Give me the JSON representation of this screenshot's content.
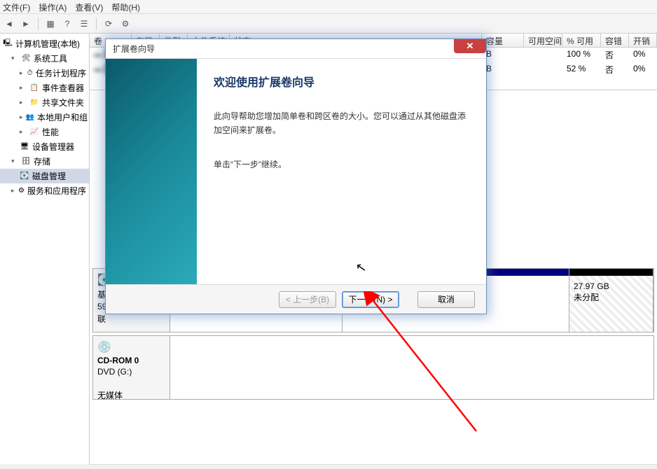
{
  "menu": {
    "file": "文件(F)",
    "action": "操作(A)",
    "view": "查看(V)",
    "help": "帮助(H)"
  },
  "tree": {
    "root": "计算机管理(本地)",
    "systools": "系统工具",
    "scheduler": "任务计划程序",
    "eventviewer": "事件查看器",
    "shared": "共享文件夹",
    "localusers": "本地用户和组",
    "perf": "性能",
    "devmgr": "设备管理器",
    "storage": "存储",
    "diskmgmt": "磁盘管理",
    "services": "服务和应用程序"
  },
  "listHeader": {
    "vol": "卷",
    "layout": "布局",
    "type": "类型",
    "fs": "文件系统",
    "status": "状态",
    "cap": "容量",
    "free": "可用空间",
    "pct": "% 可用",
    "fault": "容错",
    "over": "开销"
  },
  "rows": [
    {
      "cap": "B",
      "free": "",
      "pct": "100 %",
      "fault": "否",
      "over": "0%"
    },
    {
      "cap": "B",
      "free": "",
      "pct": "52 %",
      "fault": "否",
      "over": "0%"
    }
  ],
  "disk0": {
    "label": "基",
    "line2": "59",
    "line3": "联"
  },
  "unalloc": {
    "size": "27.97 GB",
    "status": "未分配"
  },
  "cdrom": {
    "title": "CD-ROM 0",
    "drive": "DVD (G:)",
    "status": "无媒体"
  },
  "wizard": {
    "title": "扩展卷向导",
    "heading": "欢迎使用扩展卷向导",
    "p1": "此向导帮助您增加简单卷和跨区卷的大小。您可以通过从其他磁盘添加空间来扩展卷。",
    "p2": "单击“下一步”继续。",
    "back": "< 上一步(B)",
    "next": "下一步(N) >",
    "cancel": "取消",
    "close": "✕"
  }
}
